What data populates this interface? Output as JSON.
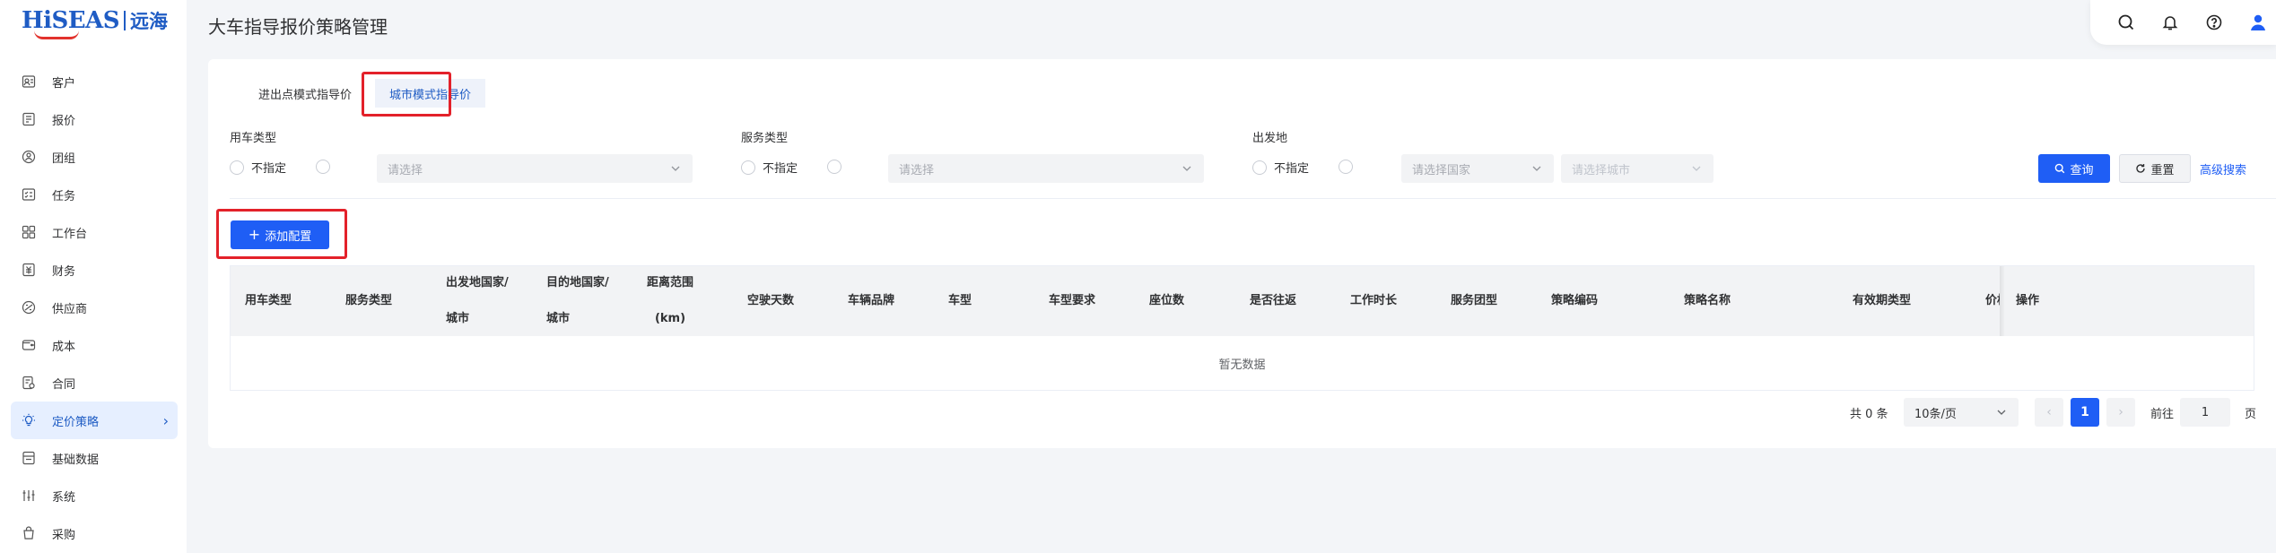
{
  "logo": {
    "brand": "HiSEAS",
    "cn": "远海"
  },
  "page_title": "大车指导报价策略管理",
  "sidebar": {
    "items": [
      {
        "label": "客户",
        "icon": "customer-icon"
      },
      {
        "label": "报价",
        "icon": "quote-icon"
      },
      {
        "label": "团组",
        "icon": "group-icon"
      },
      {
        "label": "任务",
        "icon": "task-icon"
      },
      {
        "label": "工作台",
        "icon": "workbench-icon"
      },
      {
        "label": "财务",
        "icon": "finance-icon"
      },
      {
        "label": "供应商",
        "icon": "supplier-icon"
      },
      {
        "label": "成本",
        "icon": "cost-icon"
      },
      {
        "label": "合同",
        "icon": "contract-icon"
      },
      {
        "label": "定价策略",
        "icon": "pricing-icon",
        "active": true
      },
      {
        "label": "基础数据",
        "icon": "database-icon"
      },
      {
        "label": "系统",
        "icon": "system-icon"
      },
      {
        "label": "采购",
        "icon": "purchase-icon"
      }
    ]
  },
  "header_icons": [
    "search-icon",
    "bell-icon",
    "help-icon",
    "user-icon"
  ],
  "tabs": [
    {
      "label": "进出点模式指导价",
      "active": false
    },
    {
      "label": "城市模式指导价",
      "active": true
    }
  ],
  "filters": {
    "vehicle_type": {
      "label": "用车类型",
      "radio_unspecified": "不指定",
      "placeholder": "请选择"
    },
    "service_type": {
      "label": "服务类型",
      "radio_unspecified": "不指定",
      "placeholder": "请选择"
    },
    "departure": {
      "label": "出发地",
      "radio_unspecified": "不指定",
      "country_placeholder": "请选择国家",
      "city_placeholder": "请选择城市"
    }
  },
  "actions": {
    "query": "查询",
    "reset": "重置",
    "advanced": "高级搜索",
    "add_config": "添加配置"
  },
  "table": {
    "columns": [
      "用车类型",
      "服务类型",
      "出发地国家/\n城市",
      "目的地国家/\n城市",
      "距离范围\n(km)",
      "空驶天数",
      "车辆品牌",
      "车型",
      "车型要求",
      "座位数",
      "是否往返",
      "工作时长",
      "服务团型",
      "策略编码",
      "策略名称",
      "有效期类型",
      "价格",
      "操作"
    ],
    "empty_text": "暂无数据"
  },
  "pagination": {
    "total": "共 0 条",
    "page_size": "10条/页",
    "current_page": "1",
    "goto_label": "前往",
    "goto_value": "1",
    "page_unit": "页",
    "prev": "‹",
    "next": "›"
  }
}
